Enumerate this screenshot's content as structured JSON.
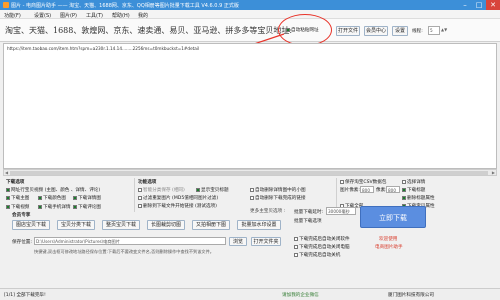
{
  "titlebar": {
    "title": "图片 - 电商图片助手 —— 淘宝、天猫、1688网、京东、QQ相册等图片批量下载工具 V4.6.0.9 正式版"
  },
  "menu": [
    "功能(F)",
    "设置(S)",
    "图片(P)",
    "工具(T)",
    "帮助(H)",
    "我的"
  ],
  "toolbar": {
    "slogan": "淘宝、天猫、1688、敦煌网、京东、速卖通、易贝、亚马逊、拼多多等宝贝地址:",
    "auto_paste": "自动粘贴网址",
    "open_file": "打开文件",
    "member": "会员中心",
    "settings": "设置",
    "threads_label": "线程:",
    "threads_value": "5"
  },
  "url_text": "https://item.taobao.com/item.htm?spm=a230r.1.14.14........2256ms=t0mkbuckst=1#detail",
  "download_options": {
    "title": "下载选项",
    "master_label": "网址行宝贝视频 (主图、颜色 、详情、评论)",
    "items": [
      "下载主图",
      "下载颜色图",
      "下载详情图",
      "下载视频",
      "下载手机详情",
      "下载评论图"
    ]
  },
  "function_options": {
    "title": "功能选项",
    "items": [
      "智能分类保存 (相同)",
      "显示宝贝标题",
      "自动删除详情图中的小图",
      "过滤重复图片 (MD5值相同图片过滤)",
      "自动删除下载完成的链接",
      "删除到下载文件开始链接 (测试选项)",
      "更多主宝贝选项 :"
    ]
  },
  "right_options": {
    "items": [
      "保存淘宝CSV数据包",
      "选择详情",
      "下载标题",
      "删除标题属性",
      "下载全部",
      "下载宝贝属性"
    ],
    "resolution_label": "图片像素:",
    "resolution_value": "800",
    "height_label": "像素:",
    "height_value": "800"
  },
  "member_tools": {
    "title": "会员专享",
    "buttons": [
      "图店宝贝下载",
      "宝贝分类下载",
      "整页宝贝下载",
      "长图裁剪切图",
      "又拍相册下图",
      "批量加水印设置"
    ]
  },
  "save_path": {
    "label": "保存位置:",
    "value": "D:\\Users\\Administrator\\Pictures\\电商图片",
    "note": "快捷键,双击框可修改地址路径保存位置:下载后不要改变文件名,否则删除操作中查找不到该文件。",
    "browse": "浏览",
    "open": "打开文件夹"
  },
  "batch": {
    "count_label": "批量下载延时:",
    "count_value": "30000毫秒",
    "subtitle": "批量下载选项",
    "items": [
      "下载完成后自动关闭软件",
      "下载完成后自动关闭电脑",
      "下载完成后自动关机"
    ]
  },
  "download_button": "立即下载",
  "ad_links": [
    "欢迎使用",
    "电商图片助手"
  ],
  "status": {
    "left": "[1/1] 全部下载完毕!",
    "center": "请加我的企业微信",
    "right": "厦门图片科技有限公司"
  },
  "colors": {
    "titlebar": "#3c8fd8",
    "accent": "#5b8ee0",
    "highlight_circle": "#e8342a"
  }
}
